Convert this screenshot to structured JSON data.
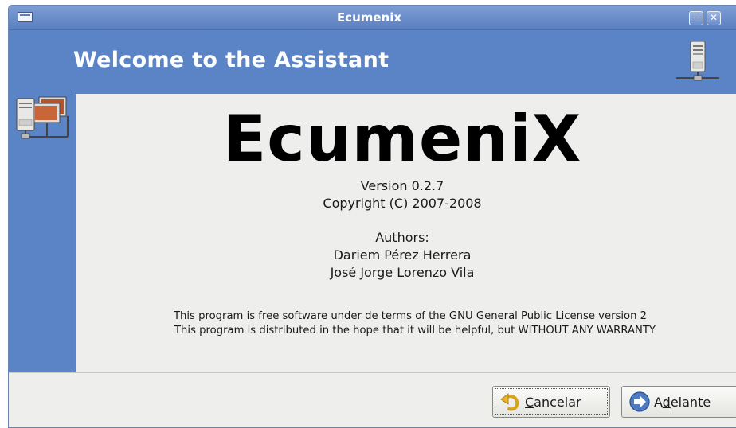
{
  "window": {
    "title": "Ecumenix",
    "minimize_glyph": "–",
    "close_glyph": "✕"
  },
  "banner": {
    "title": "Welcome to the Assistant",
    "icon": "server-icon"
  },
  "sidebar": {
    "icon": "network-computers-icon"
  },
  "about": {
    "logo": "EcumeniX",
    "version": "Version 0.2.7",
    "copyright": "Copyright (C) 2007-2008",
    "authors_label": "Authors:",
    "authors": [
      "Dariem Pérez Herrera",
      "José Jorge Lorenzo Vila"
    ],
    "license_line1": "This program is free software under de terms of the GNU General Public License version 2",
    "license_line2": "This program is distributed in the hope that it will be helpful, but WITHOUT ANY WARRANTY"
  },
  "buttons": {
    "cancel": {
      "mnemonic": "C",
      "rest": "ancelar",
      "icon": "undo-arrow-icon"
    },
    "next": {
      "before": "A",
      "mnemonic": "d",
      "rest": "elante",
      "icon": "forward-arrow-icon"
    }
  },
  "colors": {
    "banner": "#5b84c6",
    "titlebar": "#6b8fcc",
    "content_bg": "#eeeeec"
  }
}
